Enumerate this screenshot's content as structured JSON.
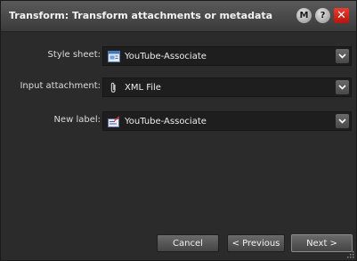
{
  "window": {
    "title": "Transform: Transform attachments or metadata",
    "controls": {
      "m_label": "M",
      "help_label": "?",
      "close_label": "✕"
    }
  },
  "form": {
    "rows": [
      {
        "label": "Style sheet:",
        "value": "YouTube-Associate",
        "icon": "stylesheet-icon"
      },
      {
        "label": "Input attachment:",
        "value": "XML File",
        "icon": "paperclip-icon"
      },
      {
        "label": "New label:",
        "value": "YouTube-Associate",
        "icon": "label-icon"
      }
    ]
  },
  "footer": {
    "cancel": "Cancel",
    "previous": "< Previous",
    "next": "Next >"
  },
  "colors": {
    "background": "#2b2b2b",
    "field": "#1e1e1e",
    "close": "#d42a1f"
  }
}
